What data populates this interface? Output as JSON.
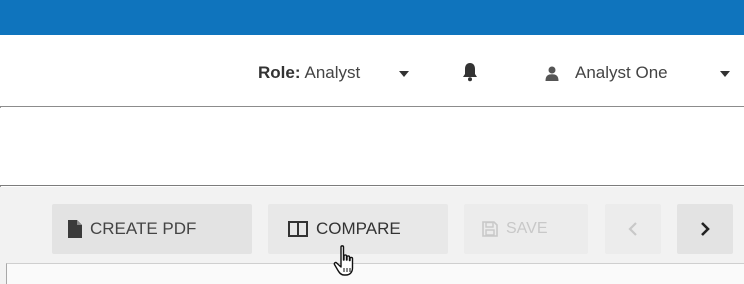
{
  "colors": {
    "topbar": "#0f74bd",
    "toolbar_bg": "#f2f2f2",
    "button_bg": "#e3e3e3",
    "disabled_text": "#c8c8c8"
  },
  "header": {
    "role_label": "Role:",
    "role_value": "Analyst",
    "notifications_icon": "bell-icon",
    "user_icon": "user-icon",
    "user_name": "Analyst One"
  },
  "toolbar": {
    "create_pdf_label": "CREATE PDF",
    "create_pdf_icon": "document-icon",
    "compare_label": "COMPARE",
    "compare_icon": "columns-icon",
    "save_label": "SAVE",
    "save_icon": "floppy-disk-icon",
    "save_disabled": true,
    "prev_icon": "chevron-left-icon",
    "next_icon": "chevron-right-icon"
  },
  "cursor": "hand-pointer"
}
